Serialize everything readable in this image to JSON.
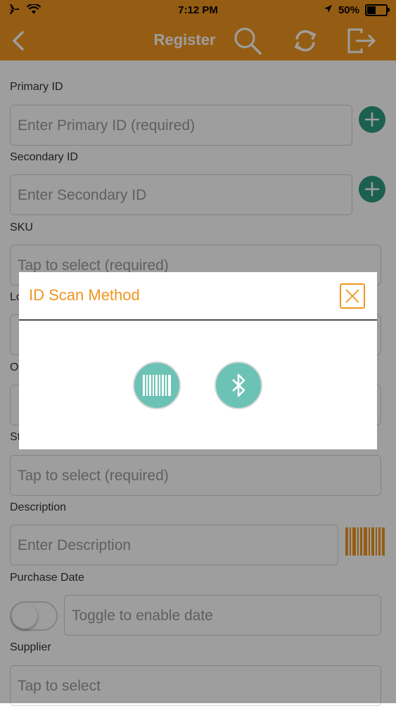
{
  "status_bar": {
    "time": "7:12 PM",
    "battery": "50%",
    "battery_level": 0.5
  },
  "header": {
    "title": "Register"
  },
  "form": {
    "primary_id": {
      "label": "Primary ID",
      "placeholder": "Enter Primary ID (required)"
    },
    "secondary_id": {
      "label": "Secondary ID",
      "placeholder": "Enter Secondary ID"
    },
    "sku": {
      "label": "SKU",
      "placeholder": "Tap to select (required)"
    },
    "hidden_label_1": "Lo",
    "hidden_label_2": "O",
    "hidden_label_3": "St",
    "status_field": {
      "placeholder": "Tap to select (required)"
    },
    "description": {
      "label": "Description",
      "placeholder": "Enter Description"
    },
    "purchase_date": {
      "label": "Purchase Date",
      "placeholder": "Toggle to enable date"
    },
    "supplier": {
      "label": "Supplier",
      "placeholder": "Tap to select"
    }
  },
  "modal": {
    "title": "ID Scan Method"
  },
  "colors": {
    "accent": "#f0961f",
    "teal": "#2e9c82",
    "teal_light": "#6cc2b5"
  }
}
